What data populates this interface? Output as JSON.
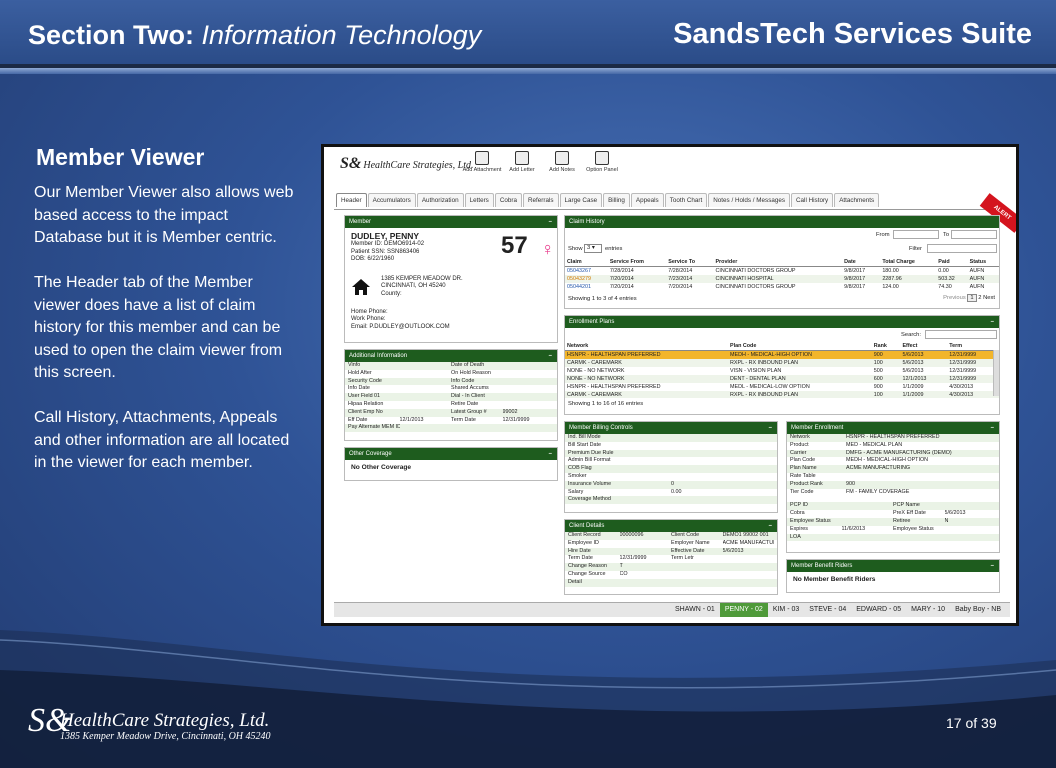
{
  "header": {
    "section_bold": "Section Two:",
    "section_italic": "Information Technology",
    "suite": "SandsTech Services Suite"
  },
  "content": {
    "title": "Member Viewer",
    "paragraphs": [
      "Our Member Viewer also allows web based access to the impact Database but it is Member centric.",
      "The Header tab of the Member viewer does have a list of claim history for this member and can be used to open the claim viewer from this screen.",
      "Call History, Attachments, Appeals and other information are all located in the viewer for each member."
    ]
  },
  "footer": {
    "logo_mark": "S&",
    "company": "HealthCare Strategies, Ltd.",
    "address": "1385 Kemper Meadow Drive, Cincinnati, OH  45240",
    "page": "17 of 39"
  },
  "app": {
    "logo": "HealthCare Strategies, Ltd.",
    "toolbar": [
      "Add Attachment",
      "Add Letter",
      "Add Notes",
      "Option Panel"
    ],
    "tabs": [
      "Header",
      "Accumulators",
      "Authorization",
      "Letters",
      "Cobra",
      "Referrals",
      "Large Case",
      "Billing",
      "Appeals",
      "Tooth Chart",
      "Notes / Holds / Messages",
      "Call History",
      "Attachments"
    ],
    "alert": "ALERT",
    "member": {
      "header": "Member",
      "name": "DUDLEY, PENNY",
      "member_id": "Member ID: DEMO6914-02",
      "ssn": "Patient SSN: SSN863406",
      "dob": "DOB: 6/22/1960",
      "age": "57",
      "addr1": "1385 KEMPER MEADOW DR.",
      "addr2": "CINCINNATI, OH 45240",
      "county": "County:",
      "home_phone": "Home Phone:",
      "work_phone": "Work Phone:",
      "email": "Email: P.DUDLEY@OUTLOOK.COM"
    },
    "additional": {
      "header": "Additional Information",
      "rows": [
        [
          "Vinfo",
          "",
          "Date of Death",
          ""
        ],
        [
          "Hold After",
          "",
          "On Hold Reason",
          ""
        ],
        [
          "Security Code",
          "",
          "Info Code",
          ""
        ],
        [
          "Info Date",
          "",
          "Shared Accums",
          ""
        ],
        [
          "User Field 01",
          "",
          "Dial - In Client",
          ""
        ],
        [
          "Hipaa Relation",
          "",
          "Retire Date",
          ""
        ],
        [
          "Client Emp No",
          "",
          "Latest Group #",
          "99002"
        ],
        [
          "Eff Date",
          "12/1/2013",
          "Term Date",
          "12/31/9999"
        ],
        [
          "Pay Alternate MEM ID",
          "",
          "",
          ""
        ]
      ]
    },
    "other_coverage": {
      "header": "Other Coverage",
      "text": "No Other Coverage"
    },
    "claims": {
      "header": "Claim History",
      "from_label": "From",
      "to_label": "To",
      "show_label": "Show",
      "show_value": "3",
      "entries_label": "entries",
      "filter_label": "Filter",
      "columns": [
        "Claim",
        "Service From",
        "Service To",
        "Provider",
        "Date",
        "Total Charge",
        "Paid",
        "Status"
      ],
      "rows": [
        [
          "05043267",
          "7/28/2014",
          "7/28/2014",
          "CINCINNATI DOCTORS GROUP",
          "9/8/2017",
          "180.00",
          "0.00",
          "AUFN"
        ],
        [
          "05043279",
          "7/20/2014",
          "7/23/2014",
          "CINCINNATI HOSPITAL",
          "9/8/2017",
          "2287.96",
          "503.32",
          "AUFN"
        ],
        [
          "05044201",
          "7/20/2014",
          "7/20/2014",
          "CINCINNATI DOCTORS GROUP",
          "9/8/2017",
          "124.00",
          "74.30",
          "AUFN"
        ]
      ],
      "summary": "Showing 1 to 3 of 4 entries",
      "pager": [
        "Previous",
        "1",
        "2",
        "Next"
      ]
    },
    "enrollment": {
      "header": "Enrollment Plans",
      "search_label": "Search:",
      "columns": [
        "Network",
        "Plan Code",
        "Rank",
        "Effect",
        "Term"
      ],
      "rows": [
        [
          "HSNPR - HEALTHSPAN PREFERRED",
          "MEDH - MEDICAL-HIGH OPTION",
          "900",
          "5/6/2013",
          "12/31/9999"
        ],
        [
          "CARMK - CAREMARK",
          "RXPL - RX INBOUND PLAN",
          "100",
          "5/6/2013",
          "12/31/9999"
        ],
        [
          "NONE - NO NETWORK",
          "VISN - VISION PLAN",
          "500",
          "5/6/2013",
          "12/31/9999"
        ],
        [
          "NONE - NO NETWORK",
          "DENT - DENTAL PLAN",
          "600",
          "12/1/2013",
          "12/31/9999"
        ],
        [
          "HSNPR - HEALTHSPAN PREFERRED",
          "MEDL - MEDICAL-LOW OPTION",
          "900",
          "1/1/2009",
          "4/30/2013"
        ],
        [
          "CARMK - CAREMARK",
          "RXPL - RX INBOUND PLAN",
          "100",
          "1/1/2009",
          "4/30/2013"
        ]
      ],
      "summary": "Showing 1 to 16 of 16 entries"
    },
    "billing": {
      "header": "Member Billing Controls",
      "rows": [
        [
          "Ind. Bill Mode",
          ""
        ],
        [
          "Bill Start Date",
          ""
        ],
        [
          "Premium Due Rule",
          ""
        ],
        [
          "Admin Bill Format",
          ""
        ],
        [
          "COB Flag",
          ""
        ],
        [
          "Smoker",
          ""
        ],
        [
          "Insurance Volume",
          "0"
        ],
        [
          "Salary",
          "0.00"
        ],
        [
          "Coverage Method",
          ""
        ]
      ]
    },
    "client": {
      "header": "Client Details",
      "rows": [
        [
          "Client Record",
          "00000096",
          "Client Code",
          "DEMO1 99002 001"
        ],
        [
          "Employee ID",
          "",
          "Employer Name",
          "ACME MANUFACTURING CORP"
        ],
        [
          "Hire Date",
          "",
          "Effective Date",
          "5/6/2013"
        ],
        [
          "Term Date",
          "12/31/9999",
          "Term Letr",
          ""
        ],
        [
          "Change Reason",
          "T",
          "",
          ""
        ],
        [
          "Change Source",
          "CO",
          "",
          ""
        ],
        [
          "Detail",
          "",
          "",
          ""
        ]
      ]
    },
    "member_enroll": {
      "header": "Member Enrollment",
      "rows": [
        [
          "Network",
          "HSNPR - HEALTHSPAN PREFERRED"
        ],
        [
          "Product",
          "MED - MEDICAL PLAN"
        ],
        [
          "Carrier",
          "DMFG - ACME MANUFACTURING (DEMO)"
        ],
        [
          "Plan Code",
          "MEDH - MEDICAL-HIGH OPTION"
        ],
        [
          "Plan Name",
          "ACME MANUFACTURING"
        ],
        [
          "Rate Table",
          ""
        ],
        [
          "Product Rank",
          "900"
        ],
        [
          "Tier Code",
          "FM - FAMILY COVERAGE"
        ]
      ],
      "rows2": [
        [
          "PCP ID",
          "",
          "PCP Name",
          ""
        ],
        [
          "Cobra",
          "",
          "PreX Eff Date",
          "5/6/2013"
        ],
        [
          "Employee Status",
          "",
          "Retiree",
          "N"
        ],
        [
          "Expires",
          "11/6/2013",
          "Employee Status",
          ""
        ],
        [
          "LOA",
          "",
          "",
          ""
        ]
      ]
    },
    "riders": {
      "header": "Member Benefit Riders",
      "text": "No Member Benefit Riders"
    },
    "family": [
      "SHAWN - 01",
      "PENNY - 02",
      "KIM - 03",
      "STEVE - 04",
      "EDWARD - 05",
      "MARY - 10",
      "Baby Boy - NB"
    ],
    "family_active": 1
  }
}
